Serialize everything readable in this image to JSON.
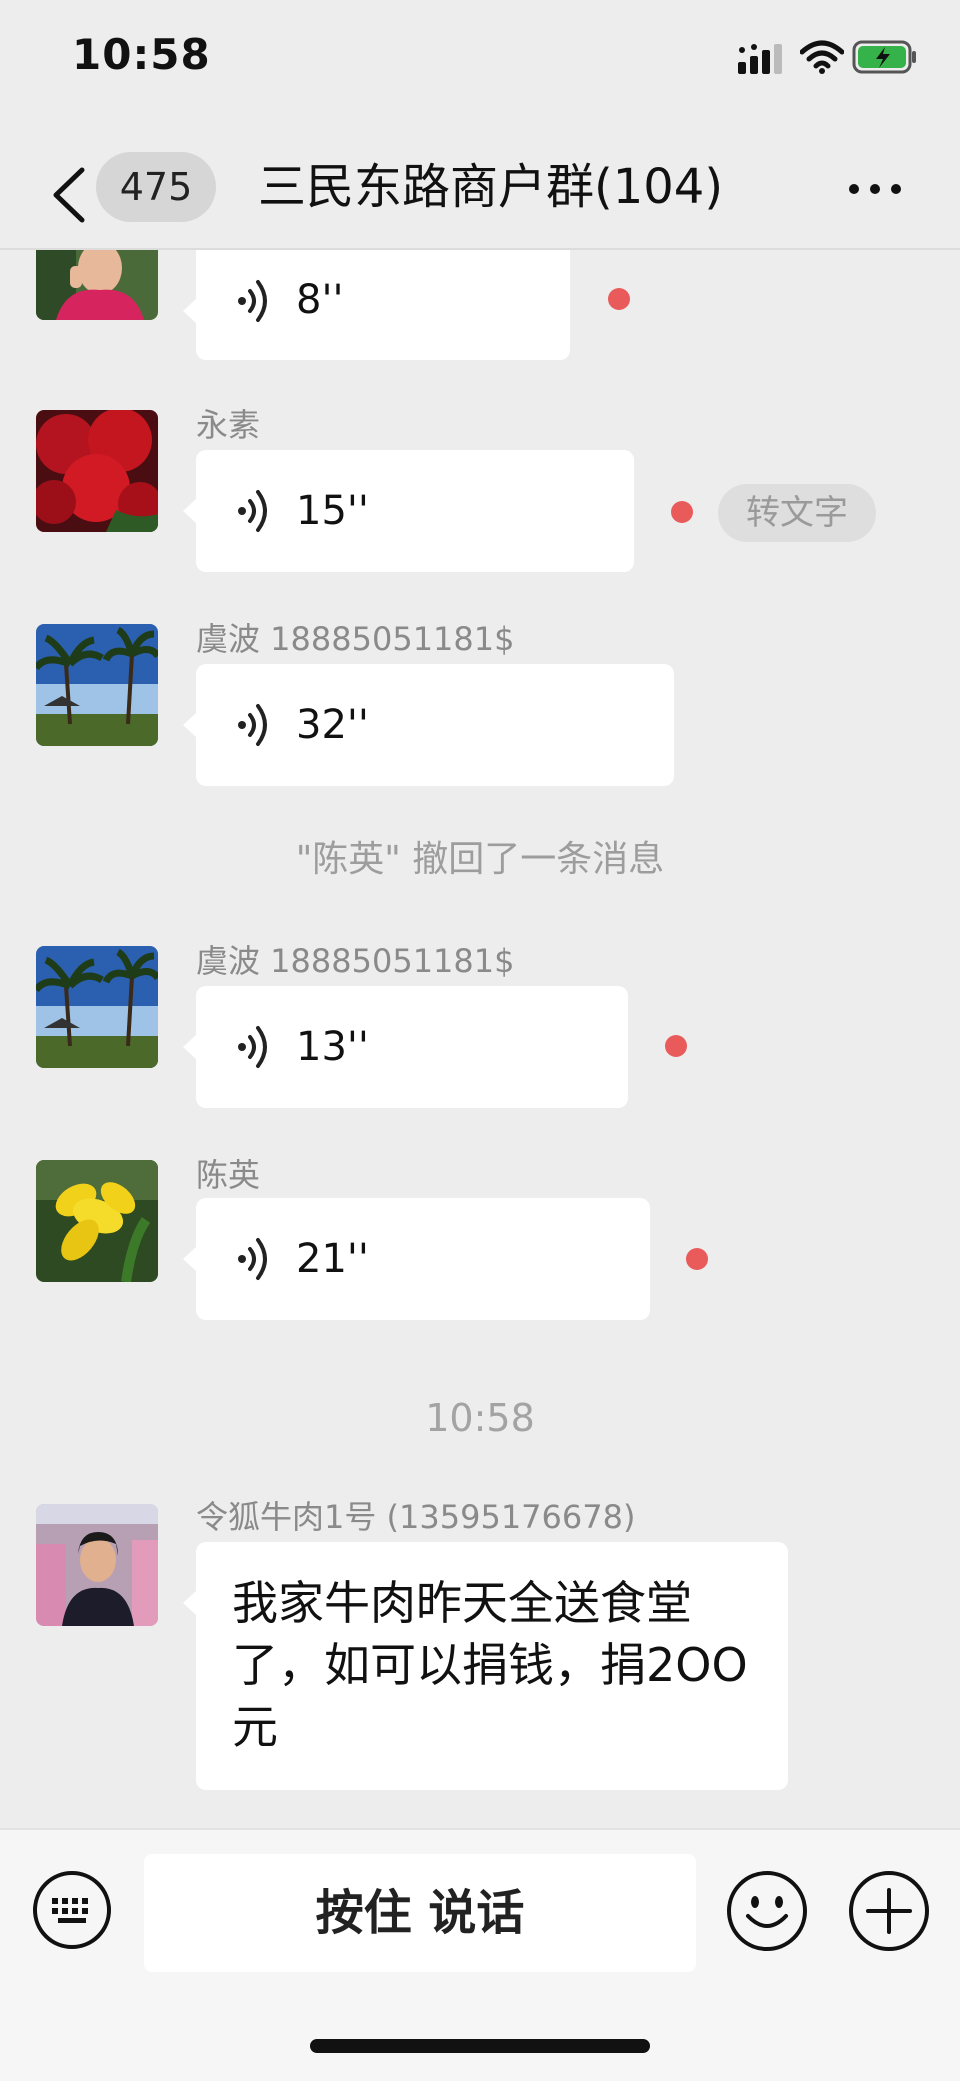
{
  "status_bar": {
    "time": "10:58"
  },
  "nav": {
    "unread_count": "475",
    "title": "三民东路商户群(104)"
  },
  "messages": [
    {
      "sender": "",
      "duration": "8''",
      "unread": true,
      "avatar_desc": "woman-in-pink"
    },
    {
      "sender": "永素",
      "duration": "15''",
      "unread": true,
      "action": "转文字",
      "avatar_desc": "red-flowers"
    },
    {
      "sender": "虞波 18885051181$",
      "duration": "32''",
      "unread": false,
      "avatar_desc": "palm-trees"
    },
    {
      "sender": "虞波 18885051181$",
      "duration": "13''",
      "unread": true,
      "avatar_desc": "palm-trees"
    },
    {
      "sender": "陈英",
      "duration": "21''",
      "unread": true,
      "avatar_desc": "yellow-flower"
    }
  ],
  "system": {
    "recall_notice": "\"陈英\" 撤回了一条消息",
    "timestamp": "10:58"
  },
  "text_message": {
    "sender": "令狐牛肉1号 (13595176678)",
    "text": "我家牛肉昨天全送食堂了，如可以捐钱，捐2OO元",
    "avatar_desc": "woman-in-market"
  },
  "input_bar": {
    "talk_label": "按住 说话"
  },
  "colors": {
    "unread_dot": "#e95b5b",
    "background": "#ededed",
    "bubble": "#ffffff"
  }
}
